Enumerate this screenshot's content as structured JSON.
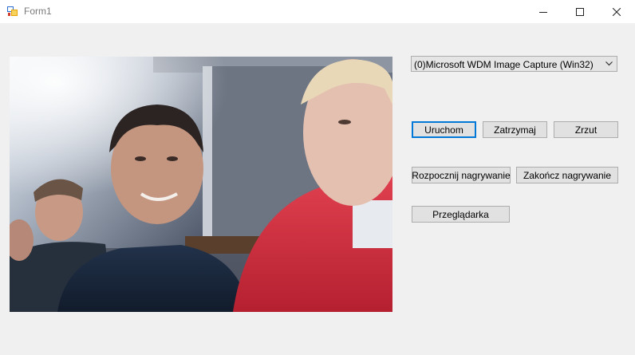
{
  "window": {
    "title": "Form1",
    "icon": "winforms-app-icon",
    "controls": [
      "minimize-icon",
      "maximize-icon",
      "close-icon"
    ]
  },
  "camera": {
    "selected_device": "(0)Microsoft WDM Image Capture (Win32)"
  },
  "buttons": {
    "start": "Uruchom",
    "stop": "Zatrzymaj",
    "snapshot": "Zrzut",
    "record_start": "Rozpocznij nagrywanie",
    "record_stop": "Zakończ nagrywanie",
    "browser": "Przeglądarka"
  },
  "colors": {
    "focus_border": "#0078d7",
    "button_face": "#e1e1e1",
    "form_background": "#f0f0f0"
  }
}
